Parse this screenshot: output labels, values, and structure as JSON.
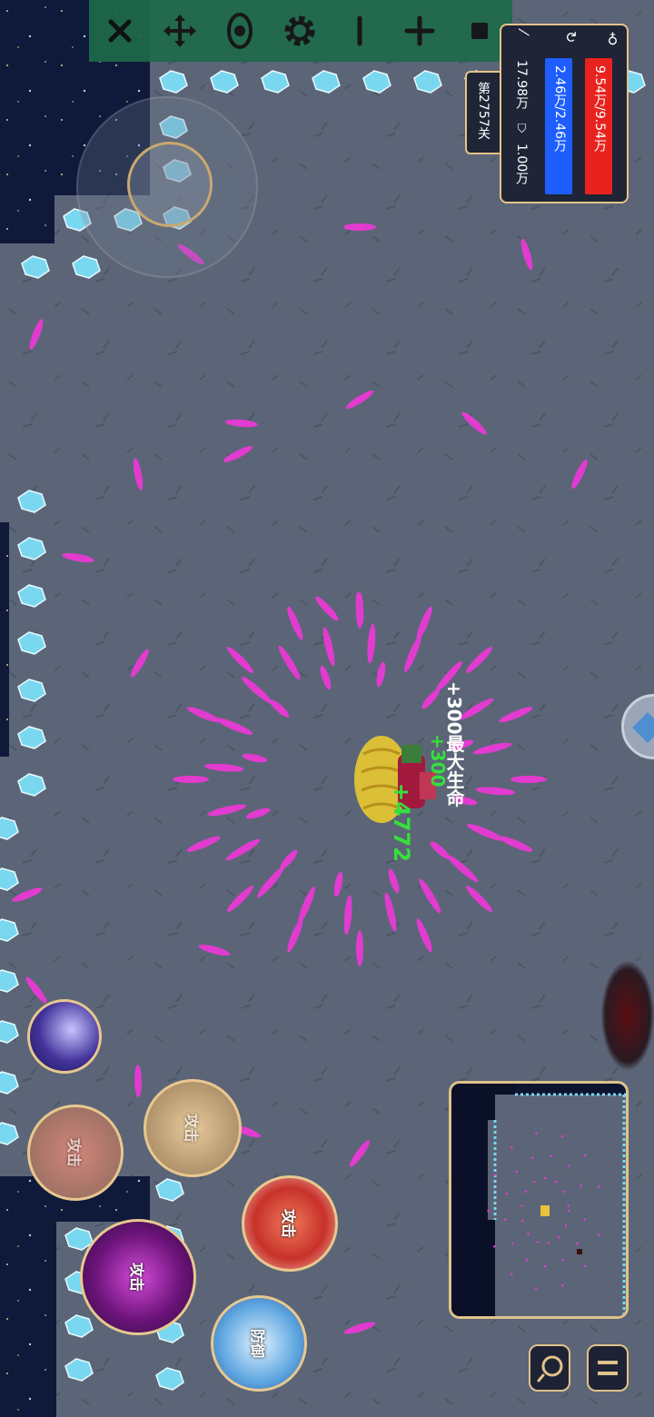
{
  "toolbar": {
    "buttons": [
      "close-icon",
      "move-icon",
      "eye-icon",
      "gear-icon",
      "minus-icon",
      "plus-icon",
      "stop-icon"
    ]
  },
  "stats": {
    "hp_text": "9.54万/9.54万",
    "mp_text": "2.46万/2.46万",
    "attack_text": "17.98万",
    "defense_text": "1.00万",
    "level_text": "第2757关",
    "hp_fill": 1.0,
    "mp_fill": 1.0,
    "hp_color": "#e8231f",
    "mp_color": "#1e5eff"
  },
  "floating_text": {
    "max_hp_gain": "+300最大生命",
    "gain_green": "+300",
    "heal_green": "+4772",
    "white_color": "#ffffff",
    "green_color": "#35e03c"
  },
  "skills": {
    "attack_labels": [
      "攻击",
      "攻击",
      "攻击",
      "攻击"
    ],
    "defense_label": "防御"
  },
  "minimap": {
    "player_marker_color": "#e7c23a",
    "enemy_marker_color": "#3a1010"
  },
  "buttons": {
    "search": "search-icon",
    "pause": "pause-icon"
  },
  "colors": {
    "floor": "#5b6577",
    "projectile": "#e23bd0",
    "crystal": "#7ad7f0",
    "frame": "#e5c487"
  }
}
